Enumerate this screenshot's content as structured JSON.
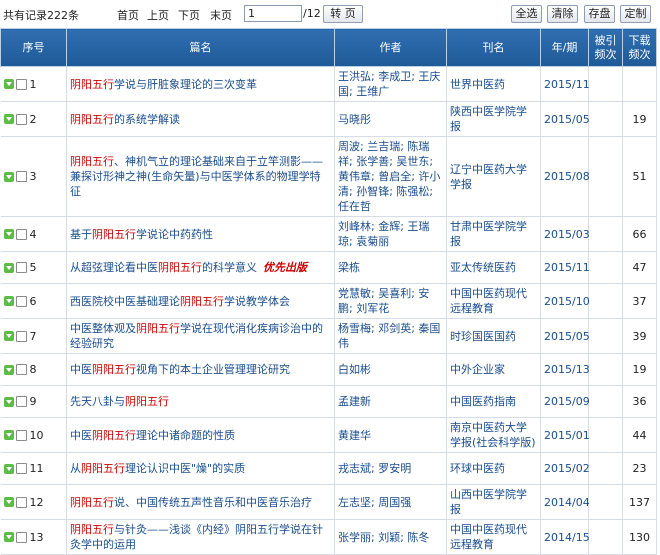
{
  "toolbar": {
    "total": "共有记录222条",
    "first": "首页",
    "prev": "上页",
    "next": "下页",
    "last": "末页",
    "page_value": "1",
    "page_total": "/12",
    "goto": "转 页",
    "select_all": "全选",
    "clear": "清除",
    "save": "存盘",
    "custom": "定制"
  },
  "columns": {
    "seq": "序号",
    "title": "篇名",
    "author": "作者",
    "source": "刊名",
    "period": "年/期",
    "cited": "被引\n频次",
    "downloads": "下载\n频次"
  },
  "rows": [
    {
      "no": "1",
      "title": [
        "",
        "阴阳五行",
        "学说与肝脏象理论的三次变革"
      ],
      "author": "王洪弘; 李成卫; 王庆国; 王维广",
      "source": "世界中医药",
      "period": "2015/11",
      "cited": "",
      "downloads": "",
      "size": "med"
    },
    {
      "no": "2",
      "title": [
        "",
        "阴阳五行",
        "的系统学解读"
      ],
      "author": "马晓彤",
      "source": "陕西中医学院学报",
      "period": "2015/05",
      "cited": "",
      "downloads": "19",
      "size": ""
    },
    {
      "no": "3",
      "title": [
        "",
        "阴阳五行",
        "、神机气立的理论基础来自于立竿测影——兼探讨形神之神(生命矢量)与中医学体系的物理学特征"
      ],
      "author": "周波; 兰吉瑞; 陈瑞祥; 张学善; 吴世东; 黄伟章; 曾启全; 许小清; 孙智锋; 陈强松; 任在哲",
      "source": "辽宁中医药大学学报",
      "period": "2015/08",
      "cited": "",
      "downloads": "51",
      "size": "tall"
    },
    {
      "no": "4",
      "title": [
        "基于",
        "阴阳五行",
        "学说论中药药性"
      ],
      "author": "刘峰林; 金辉; 王瑞琼; 袁菊丽",
      "source": "甘肃中医学院学报",
      "period": "2015/03",
      "cited": "",
      "downloads": "66",
      "size": "med"
    },
    {
      "no": "5",
      "title": [
        "从超弦理论看中医",
        "阴阳五行",
        "的科学意义"
      ],
      "author": "梁栋",
      "source": "亚太传统医药",
      "period": "2015/11",
      "cited": "",
      "downloads": "47",
      "size": "",
      "flag": "优先出版"
    },
    {
      "no": "6",
      "title": [
        "西医院校中医基础理论",
        "阴阳五行",
        "学说教学体会"
      ],
      "author": "党慧敏; 吴喜利; 安鹏; 刘军花",
      "source": "中国中医药现代远程教育",
      "period": "2015/10",
      "cited": "",
      "downloads": "37",
      "size": "med"
    },
    {
      "no": "7",
      "title": [
        "中医整体观及",
        "阴阳五行",
        "学说在现代消化疾病诊治中的经验研究"
      ],
      "author": "杨雪梅; 邓剑英; 秦国伟",
      "source": "时珍国医国药",
      "period": "2015/05",
      "cited": "",
      "downloads": "39",
      "size": "med"
    },
    {
      "no": "8",
      "title": [
        "中医",
        "阴阳五行",
        "视角下的本土企业管理理论研究"
      ],
      "author": "白如彬",
      "source": "中外企业家",
      "period": "2015/13",
      "cited": "",
      "downloads": "19",
      "size": ""
    },
    {
      "no": "9",
      "title": [
        "先天八卦与",
        "阴阳五行",
        ""
      ],
      "author": "孟建新",
      "source": "中国医药指南",
      "period": "2015/09",
      "cited": "",
      "downloads": "36",
      "size": ""
    },
    {
      "no": "10",
      "title": [
        "中医",
        "阴阳五行",
        "理论中诸命题的性质"
      ],
      "author": "黄建华",
      "source": "南京中医药大学学报(社会科学版)",
      "period": "2015/01",
      "cited": "",
      "downloads": "44",
      "size": "med"
    },
    {
      "no": "11",
      "title": [
        "从",
        "阴阳五行",
        "理论认识中医\"燥\"的实质"
      ],
      "author": "戎志斌; 罗安明",
      "source": "环球中医药",
      "period": "2015/02",
      "cited": "",
      "downloads": "23",
      "size": ""
    },
    {
      "no": "12",
      "title": [
        "",
        "阴阳五行",
        "说、中国传统五声性音乐和中医音乐治疗"
      ],
      "author": "左志坚; 周国强",
      "source": "山西中医学院学报",
      "period": "2014/04",
      "cited": "",
      "downloads": "137",
      "size": ""
    },
    {
      "no": "13",
      "title": [
        "",
        "阴阳五行",
        "与针灸——浅谈《内经》阴阳五行学说在针灸学中的运用"
      ],
      "author": "张学丽; 刘颖; 陈冬",
      "source": "中国中医药现代远程教育",
      "period": "2014/15",
      "cited": "",
      "downloads": "130",
      "size": "med"
    }
  ]
}
